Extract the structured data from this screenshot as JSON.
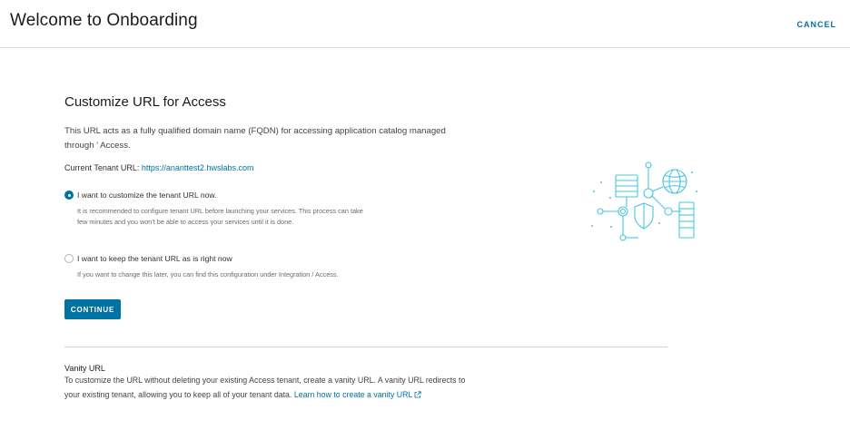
{
  "header": {
    "title": "Welcome to Onboarding",
    "cancel_label": "CANCEL"
  },
  "main": {
    "section_title": "Customize URL for Access",
    "description": "This URL acts as a fully qualified domain name (FQDN) for accessing application catalog managed through ' Access.",
    "tenant_label": "Current Tenant URL: ",
    "tenant_url": "https://ananttest2.hwslabs.com",
    "options": [
      {
        "label": "I want to customize the tenant URL now.",
        "help": "It is recommended to configure tenant URL before launching your services. This process can take few minutes and you won't be able to access your services until it is done.",
        "selected": true
      },
      {
        "label": "I want to keep the tenant URL as is right now",
        "help": "If you want to change this later, you can find this configuration under Integration / Access.",
        "selected": false
      }
    ],
    "continue_label": "CONTINUE"
  },
  "vanity": {
    "title": "Vanity URL",
    "text": "To customize the URL without deleting your existing  Access tenant, create a vanity URL. A vanity URL redirects to your existing tenant, allowing you to keep all of your tenant data. ",
    "link_label": "Learn how to create a vanity URL"
  },
  "colors": {
    "accent": "#0072a3",
    "illustration": "#49c5de"
  },
  "icons": {
    "illustration": "network-security-illustration",
    "external_link": "external-link-icon"
  }
}
